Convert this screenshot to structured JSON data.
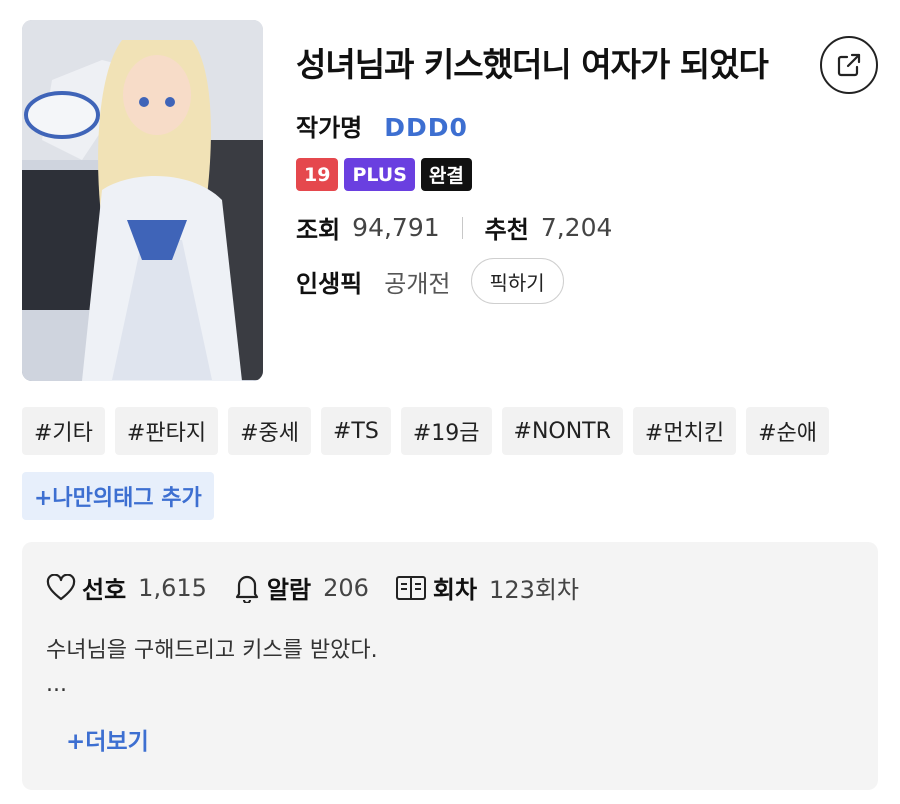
{
  "work": {
    "title": "성녀님과 키스했더니 여자가 되었다",
    "cover_alt": "cover illustration"
  },
  "author": {
    "label": "작가명",
    "name": "DDD0"
  },
  "badges": {
    "age": "19",
    "plus": "PLUS",
    "status": "완결"
  },
  "stats": {
    "views_label": "조회",
    "views_value": "94,791",
    "recommend_label": "추천",
    "recommend_value": "7,204"
  },
  "pick": {
    "label": "인생픽",
    "status": "공개전",
    "button": "픽하기"
  },
  "tags": [
    "#기타",
    "#판타지",
    "#중세",
    "#TS",
    "#19금",
    "#NONTR",
    "#먼치킨",
    "#순애"
  ],
  "tag_add": "+나만의태그 추가",
  "meta": {
    "favorite_label": "선호",
    "favorite_value": "1,615",
    "alarm_label": "알람",
    "alarm_value": "206",
    "episodes_label": "회차",
    "episodes_value": "123회차"
  },
  "synopsis": {
    "line1": "수녀님을 구해드리고 키스를 받았다.",
    "line2": "...",
    "more": "+더보기"
  },
  "colors": {
    "accent": "#3d6fd1",
    "age_badge": "#e5484d",
    "plus_badge": "#6a3fe0",
    "done_badge": "#111111"
  }
}
